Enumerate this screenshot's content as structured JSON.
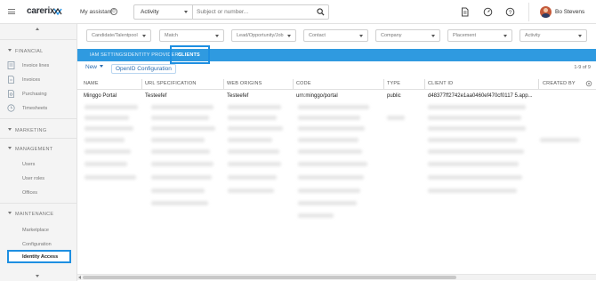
{
  "topbar": {
    "logo": "carerix",
    "assistant_label": "My assistant",
    "search_type": "Activity",
    "search_placeholder": "Subject or number...",
    "username": "Bo Stevens"
  },
  "sidebar": {
    "sections": [
      {
        "title": "FINANCIAL",
        "items": [
          {
            "label": "Invoice lines",
            "icon": "invoice-lines-icon"
          },
          {
            "label": "Invoices",
            "icon": "invoice-icon"
          },
          {
            "label": "Purchasing",
            "icon": "purchasing-icon"
          },
          {
            "label": "Timesheets",
            "icon": "timesheets-icon"
          }
        ]
      },
      {
        "title": "MARKETING",
        "items": []
      },
      {
        "title": "MANAGEMENT",
        "items": [
          {
            "label": "Users"
          },
          {
            "label": "User roles"
          },
          {
            "label": "Offices"
          }
        ]
      },
      {
        "title": "MAINTENANCE",
        "items": [
          {
            "label": "Marketplace"
          },
          {
            "label": "Configuration"
          },
          {
            "label": "Identity Access"
          }
        ]
      }
    ]
  },
  "filters": [
    "Candidate/Talentpool",
    "Match",
    "Lead/Opportunity/Job",
    "Contact",
    "Company",
    "Placement",
    "Activity"
  ],
  "tabs": [
    "IAM SETTINGS",
    "IDENTITY PROVIDERS",
    "CLIENTS"
  ],
  "toolbar": {
    "new_label": "New",
    "oidc_label": "OpenID Configuration",
    "count": "1-9 of 9"
  },
  "table": {
    "columns": [
      "NAME",
      "URL SPECIFICATION",
      "WEB ORIGINS",
      "CODE",
      "TYPE",
      "CLIENT ID",
      "CREATED BY"
    ],
    "rows": [
      [
        "Minggo Portal",
        "Testeefef",
        "Testeefef",
        "urn:minggo/portal",
        "public",
        "d48377ff2742e1aa0460ef470cf0117 5.app...",
        ""
      ]
    ]
  },
  "colors": {
    "accent": "#2f9ae0",
    "highlight": "#1e8fe1",
    "link": "#2b6cb0"
  }
}
